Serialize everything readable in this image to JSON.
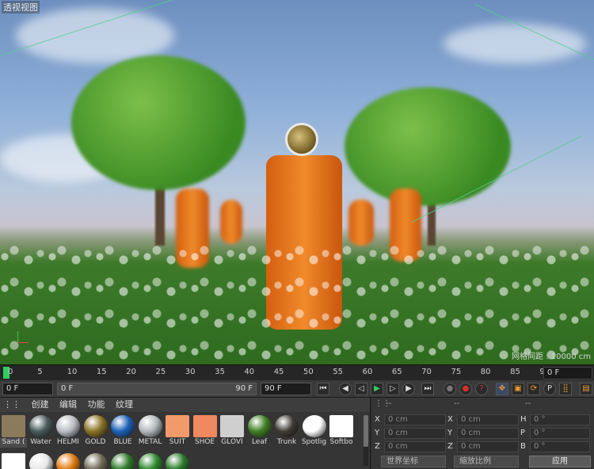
{
  "viewport": {
    "title": "透视视图",
    "grid_label": "网格间距 : 10000 cm"
  },
  "timeline": {
    "ticks": [
      "0",
      "5",
      "10",
      "15",
      "20",
      "25",
      "30",
      "35",
      "40",
      "45",
      "50",
      "55",
      "60",
      "65",
      "70",
      "75",
      "80",
      "85",
      "90"
    ],
    "end_field": "0 F"
  },
  "transport": {
    "start_field": "0 F",
    "range_start": "0 F",
    "range_end": "90 F",
    "end_field": "90 F",
    "buttons": [
      "first-frame",
      "prev-key",
      "prev-frame",
      "play",
      "next-frame",
      "next-key",
      "last-frame",
      "record-off",
      "record",
      "autokey",
      "move",
      "scale",
      "rotate",
      "param",
      "pla",
      "timeline"
    ]
  },
  "materials": {
    "menu": [
      "创建",
      "编辑",
      "功能",
      "纹理"
    ],
    "items": [
      {
        "label": "Sand (",
        "color": "#8b7b5a",
        "shape": "square"
      },
      {
        "label": "Water",
        "color": "#4a5b5c",
        "shape": "ball"
      },
      {
        "label": "HELMI",
        "color": "#b9bcc2",
        "shape": "ball"
      },
      {
        "label": "GOLD",
        "color": "#8a7324",
        "shape": "ball"
      },
      {
        "label": "BLUE",
        "color": "#1b5fb8",
        "shape": "ball"
      },
      {
        "label": "METAL",
        "color": "#b4b7bd",
        "shape": "ball"
      },
      {
        "label": "SUIT",
        "color": "#f39a6a",
        "shape": "square"
      },
      {
        "label": "SHOE",
        "color": "#f08860",
        "shape": "square"
      },
      {
        "label": "GLOVI",
        "color": "#cfcfcf",
        "shape": "square"
      },
      {
        "label": "Leaf",
        "color": "#3f7f22",
        "shape": "ball"
      },
      {
        "label": "Trunk",
        "color": "#3f3a34",
        "shape": "ball"
      },
      {
        "label": "Spotlig",
        "color": "#ffffff",
        "shape": "ball"
      },
      {
        "label": "Softbo",
        "color": "#ffffff",
        "shape": "square"
      }
    ],
    "row2": [
      {
        "color": "#ffffff",
        "shape": "square"
      },
      {
        "color": "#e8e8e8",
        "shape": "ball"
      },
      {
        "color": "#e07a10",
        "shape": "ball"
      },
      {
        "color": "#6e6a55",
        "shape": "ball"
      },
      {
        "color": "#2f7a2a",
        "shape": "ball"
      },
      {
        "color": "#2f8a2e",
        "shape": "ball"
      },
      {
        "color": "#2a7a28",
        "shape": "ball"
      }
    ]
  },
  "coords": {
    "head": [
      "--",
      "--",
      "--"
    ],
    "rows": [
      {
        "a": "X",
        "av": "0 cm",
        "b": "X",
        "bv": "0 cm",
        "c": "H",
        "cv": "0 °"
      },
      {
        "a": "Y",
        "av": "0 cm",
        "b": "Y",
        "bv": "0 cm",
        "c": "P",
        "cv": "0 °"
      },
      {
        "a": "Z",
        "av": "0 cm",
        "b": "Z",
        "bv": "0 cm",
        "c": "B",
        "cv": "0 °"
      }
    ],
    "world": "世界坐标",
    "scale": "缩放比例",
    "apply": "应用"
  },
  "colors": {
    "accent": "#2ed060",
    "record": "#d03030"
  }
}
